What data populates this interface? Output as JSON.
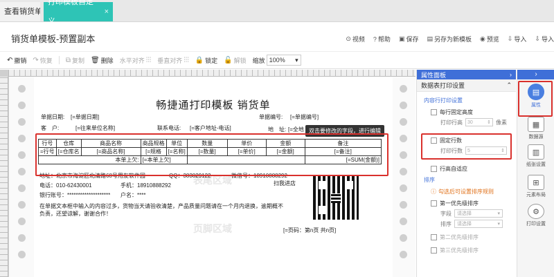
{
  "tabs": [
    {
      "label": "查看销货单"
    },
    {
      "label": "打印模板自定义",
      "close": "×"
    }
  ],
  "page_title": "销货单模板-预置副本",
  "header_buttons": [
    {
      "label": "视频",
      "icon": "video-icon"
    },
    {
      "label": "帮助",
      "icon": "help-icon"
    },
    {
      "label": "保存",
      "icon": "save-icon"
    },
    {
      "label": "另存为新模板",
      "icon": "save-as-icon"
    },
    {
      "label": "预览",
      "icon": "preview-icon"
    },
    {
      "label": "导入",
      "icon": "import-icon"
    },
    {
      "label": "导入",
      "icon": "import-icon"
    }
  ],
  "toolbar": {
    "undo": "撤销",
    "redo": "恢复",
    "copy": "复制",
    "delete": "删除",
    "h_align": "水平对齐",
    "v_align": "垂直对齐",
    "lock": "锁定",
    "unlock": "解锁",
    "zoom_label": "缩放",
    "zoom_value": "100%"
  },
  "document": {
    "title": "畅捷通打印模板 销货单",
    "date_label": "单据日期:",
    "date_value": "[=单据日期]",
    "no_label": "单据编号:",
    "no_value": "[=单据编号]",
    "customer_label": "客　户:",
    "customer_value": "[=往来单位名称]",
    "phone_label": "联系电话:",
    "phone_value": "[=客户地址-电话]",
    "addr_label": "地　址:",
    "addr_value": "[=全地",
    "tooltip": "双击要修改的字段，进行编辑",
    "watermarks": [
      "表头区域",
      "表尾区域",
      "页脚区域"
    ],
    "table_headers": [
      "行号",
      "仓库",
      "商品名称",
      "商品规格",
      "单位",
      "数量",
      "单价",
      "金额",
      "备注"
    ],
    "table_row": [
      "=行号",
      "[=仓库名",
      "[=商品名称]",
      "[=规格",
      "[=名称]",
      "[=数量]",
      "[=单价]",
      "[=金额]",
      "[=备注]"
    ],
    "summary_label": "本单上欠:",
    "summary_value": "[=本单上欠]",
    "summary_total": "[=SUM(金额)]",
    "footer_address": "地址：北京市海淀区北清路68号用友软件园",
    "footer_qq": "QQ：383829122",
    "footer_wechat": "微信号：18910888292",
    "footer_tel": "电话：010-62430001",
    "footer_mobile": "手机：18910888292",
    "footer_bank": "银行账号：********************",
    "footer_account": "户名：****",
    "footer_note1": "在单据文本框中输入的内容过多，货物当天请验收清楚，产品质量问题请在一个月内退换，逾期概不",
    "footer_note2": "负责，还望谅解，谢谢合作！",
    "scan_label": "扫我进店",
    "page_label": "[=页码：第n页 共n页]"
  },
  "panel": {
    "header": "属性面板",
    "header_arrow": "›",
    "sub": "数据表打印设置",
    "sub_arrow": "⌃",
    "section1": "内容行打印设置",
    "fixed_height": "每行固定高度",
    "print_height_label": "打印行高",
    "print_height_value": "30",
    "unit": "像素",
    "fixed_rows": "固定行数",
    "print_rows_label": "打印行数",
    "print_rows_value": "5",
    "auto_height": "行高自适应",
    "section2": "排序",
    "sort_hint": "勾选后可设置排序规则",
    "first_sort": "第一优先级排序",
    "field_label": "字段",
    "field_placeholder": "请选择",
    "order_label": "排序",
    "order_placeholder": "请选择",
    "second_sort": "第二优先级排序",
    "third_sort": "第三优先级排序"
  },
  "rail": [
    {
      "label": "属性",
      "icon": "property-icon"
    },
    {
      "label": "数据源",
      "icon": "datasource-icon"
    },
    {
      "label": "纸张设置",
      "icon": "paper-icon"
    },
    {
      "label": "元素布局",
      "icon": "layout-icon"
    },
    {
      "label": "打印设置",
      "icon": "print-settings-icon"
    }
  ],
  "colors": {
    "accent": "#2ec4b6",
    "blue": "#3f6fd8",
    "highlight": "#d9302c"
  }
}
